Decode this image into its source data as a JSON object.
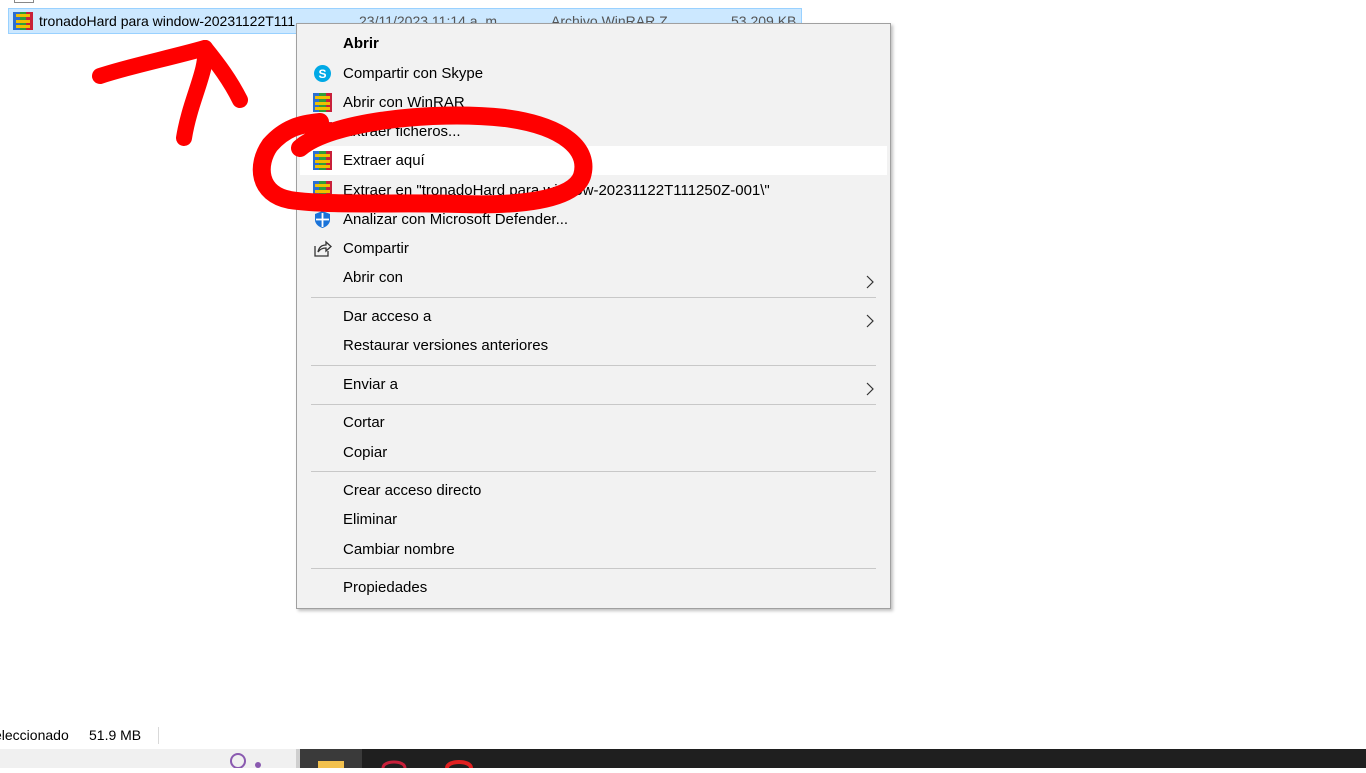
{
  "explorer": {
    "file": {
      "name": "tronadoHard para window-20231122T111",
      "date": "23/11/2023 11:14 a. m.",
      "type": "Archivo WinRAR Z...",
      "size": "53.209 KB"
    }
  },
  "context_menu": {
    "items": [
      {
        "label": "Abrir",
        "icon": "none"
      },
      {
        "label": "Compartir con Skype",
        "icon": "skype-icon"
      },
      {
        "label": "Abrir con WinRAR",
        "icon": "winrar-icon"
      },
      {
        "label": "Extraer ficheros...",
        "icon": "winrar-icon"
      },
      {
        "label": "Extraer aquí",
        "icon": "winrar-icon"
      },
      {
        "label": "Extraer en \"tronadoHard para window-20231122T111250Z-001\\\"",
        "icon": "winrar-icon"
      },
      {
        "label": "Analizar con Microsoft Defender...",
        "icon": "defender-icon"
      },
      {
        "label": "Compartir",
        "icon": "share-icon"
      },
      {
        "label": "Abrir con",
        "icon": "chevron-right-icon"
      },
      {
        "label": "Dar acceso a",
        "icon": "chevron-right-icon"
      },
      {
        "label": "Restaurar versiones anteriores",
        "icon": "none"
      },
      {
        "label": "Enviar a",
        "icon": "chevron-right-icon"
      },
      {
        "label": "Cortar",
        "icon": "none"
      },
      {
        "label": "Copiar",
        "icon": "none"
      },
      {
        "label": "Crear acceso directo",
        "icon": "none"
      },
      {
        "label": "Eliminar",
        "icon": "none"
      },
      {
        "label": "Cambiar nombre",
        "icon": "none"
      },
      {
        "label": "Propiedades",
        "icon": "none"
      }
    ],
    "highlighted": "Extraer aquí"
  },
  "status_bar": {
    "selection": "eleccionado",
    "size": "51.9 MB"
  },
  "colors": {
    "selection_bg": "#cce8ff",
    "menu_bg": "#f2f2f2",
    "annotation": "#ff0000",
    "taskbar": "#1f1f1f"
  }
}
